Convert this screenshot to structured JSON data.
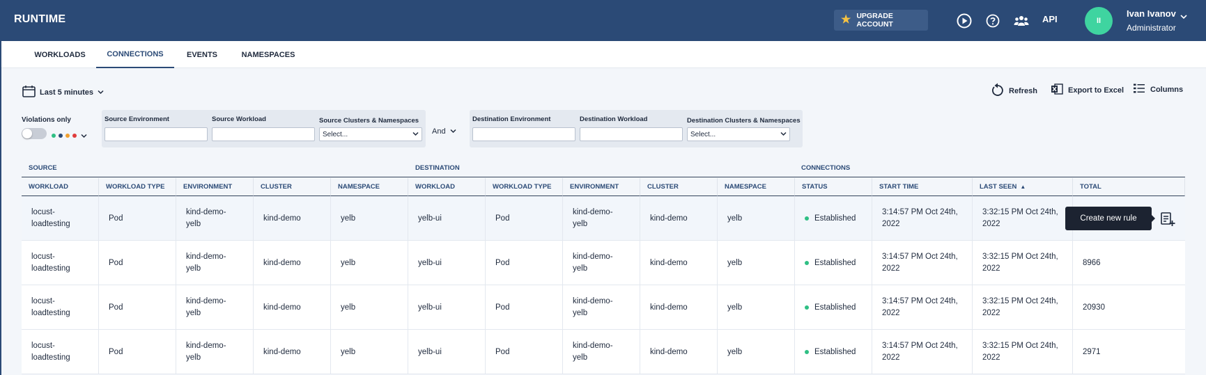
{
  "app": {
    "title": "RUNTIME"
  },
  "header": {
    "upgrade_label": "UPGRADE ACCOUNT",
    "api_label": "API",
    "user": {
      "initials": "II",
      "name": "Ivan Ivanov",
      "role": "Administrator"
    }
  },
  "tabs": [
    {
      "label": "WORKLOADS",
      "active": false
    },
    {
      "label": "CONNECTIONS",
      "active": true
    },
    {
      "label": "EVENTS",
      "active": false
    },
    {
      "label": "NAMESPACES",
      "active": false
    }
  ],
  "toolbar": {
    "time_range": "Last 5 minutes",
    "refresh": "Refresh",
    "export": "Export to Excel",
    "columns": "Columns"
  },
  "filters": {
    "violations_only": "Violations only",
    "severity_colors": [
      "#2fbf84",
      "#2b4a76",
      "#f0a030",
      "#e03c3c"
    ],
    "source": {
      "environment_label": "Source Environment",
      "environment_value": "",
      "workload_label": "Source Workload",
      "workload_value": "",
      "clusters_label": "Source Clusters & Namespaces",
      "clusters_placeholder": "Select..."
    },
    "operator": "And",
    "destination": {
      "environment_label": "Destination Environment",
      "environment_value": "",
      "workload_label": "Destination Workload",
      "workload_value": "",
      "clusters_label": "Destination Clusters & Namespaces",
      "clusters_placeholder": "Select..."
    }
  },
  "table": {
    "groups": {
      "source": "SOURCE",
      "destination": "DESTINATION",
      "connections": "CONNECTIONS"
    },
    "columns": [
      "WORKLOAD",
      "WORKLOAD TYPE",
      "ENVIRONMENT",
      "CLUSTER",
      "NAMESPACE",
      "WORKLOAD",
      "WORKLOAD TYPE",
      "ENVIRONMENT",
      "CLUSTER",
      "NAMESPACE",
      "STATUS",
      "START TIME",
      "LAST SEEN",
      "TOTAL"
    ],
    "sorted_column": "LAST SEEN",
    "sort_direction": "ascending",
    "rows": [
      [
        "locust-loadtesting",
        "Pod",
        "kind-demo-yelb",
        "kind-demo",
        "yelb",
        "yelb-ui",
        "Pod",
        "kind-demo-yelb",
        "kind-demo",
        "yelb",
        "Established",
        "3:14:57 PM Oct 24th, 2022",
        "3:32:15 PM Oct 24th, 2022",
        ""
      ],
      [
        "locust-loadtesting",
        "Pod",
        "kind-demo-yelb",
        "kind-demo",
        "yelb",
        "yelb-ui",
        "Pod",
        "kind-demo-yelb",
        "kind-demo",
        "yelb",
        "Established",
        "3:14:57 PM Oct 24th, 2022",
        "3:32:15 PM Oct 24th, 2022",
        "8966"
      ],
      [
        "locust-loadtesting",
        "Pod",
        "kind-demo-yelb",
        "kind-demo",
        "yelb",
        "yelb-ui",
        "Pod",
        "kind-demo-yelb",
        "kind-demo",
        "yelb",
        "Established",
        "3:14:57 PM Oct 24th, 2022",
        "3:32:15 PM Oct 24th, 2022",
        "20930"
      ],
      [
        "locust-loadtesting",
        "Pod",
        "kind-demo-yelb",
        "kind-demo",
        "yelb",
        "yelb-ui",
        "Pod",
        "kind-demo-yelb",
        "kind-demo",
        "yelb",
        "Established",
        "3:14:57 PM Oct 24th, 2022",
        "3:32:15 PM Oct 24th, 2022",
        "2971"
      ]
    ],
    "tooltip": "Create new rule"
  }
}
